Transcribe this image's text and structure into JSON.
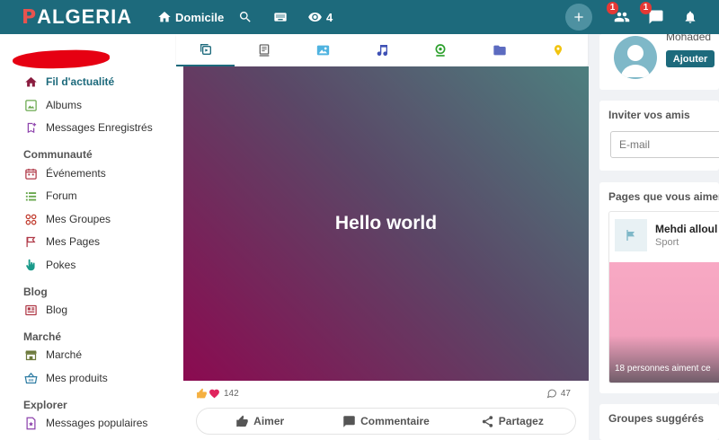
{
  "header": {
    "logo": "ALGERIA",
    "nav": {
      "home_label": "Domicile",
      "views_count": "4"
    },
    "friends_badge": "1",
    "messages_badge": "1"
  },
  "sidebar": {
    "items": [
      {
        "label": "Fil d'actualité"
      },
      {
        "label": "Albums"
      },
      {
        "label": "Messages Enregistrés"
      }
    ],
    "sections": {
      "community": {
        "title": "Communauté",
        "items": [
          "Événements",
          "Forum",
          "Mes Groupes",
          "Mes Pages",
          "Pokes"
        ]
      },
      "blog": {
        "title": "Blog",
        "items": [
          "Blog"
        ]
      },
      "market": {
        "title": "Marché",
        "items": [
          "Marché",
          "Mes produits"
        ]
      },
      "explore": {
        "title": "Explorer",
        "items": [
          "Messages populaires"
        ]
      }
    }
  },
  "composer": {
    "tabs": [
      "publish-icon",
      "text-icon",
      "photo-icon",
      "music-icon",
      "video-icon",
      "folder-icon",
      "location-icon"
    ]
  },
  "post": {
    "text": "Hello world",
    "reactions_count": "142",
    "comments_count": "47",
    "actions": {
      "like": "Aimer",
      "comment": "Commentaire",
      "share": "Partagez"
    }
  },
  "right": {
    "profile": {
      "name": "Mohaded",
      "add_label": "Ajouter"
    },
    "invite": {
      "title": "Inviter vos amis",
      "placeholder": "E-mail"
    },
    "pages": {
      "title": "Pages que vous aimerez",
      "page_name": "Mehdi alloul",
      "category": "Sport",
      "likes_text": "18 personnes aiment ce"
    },
    "groups": {
      "title": "Groupes suggérés"
    }
  },
  "colors": {
    "primary": "#1d6a7c",
    "badge": "#e53935",
    "like_blue": "#1877f2",
    "heart_red": "#e0245e"
  }
}
